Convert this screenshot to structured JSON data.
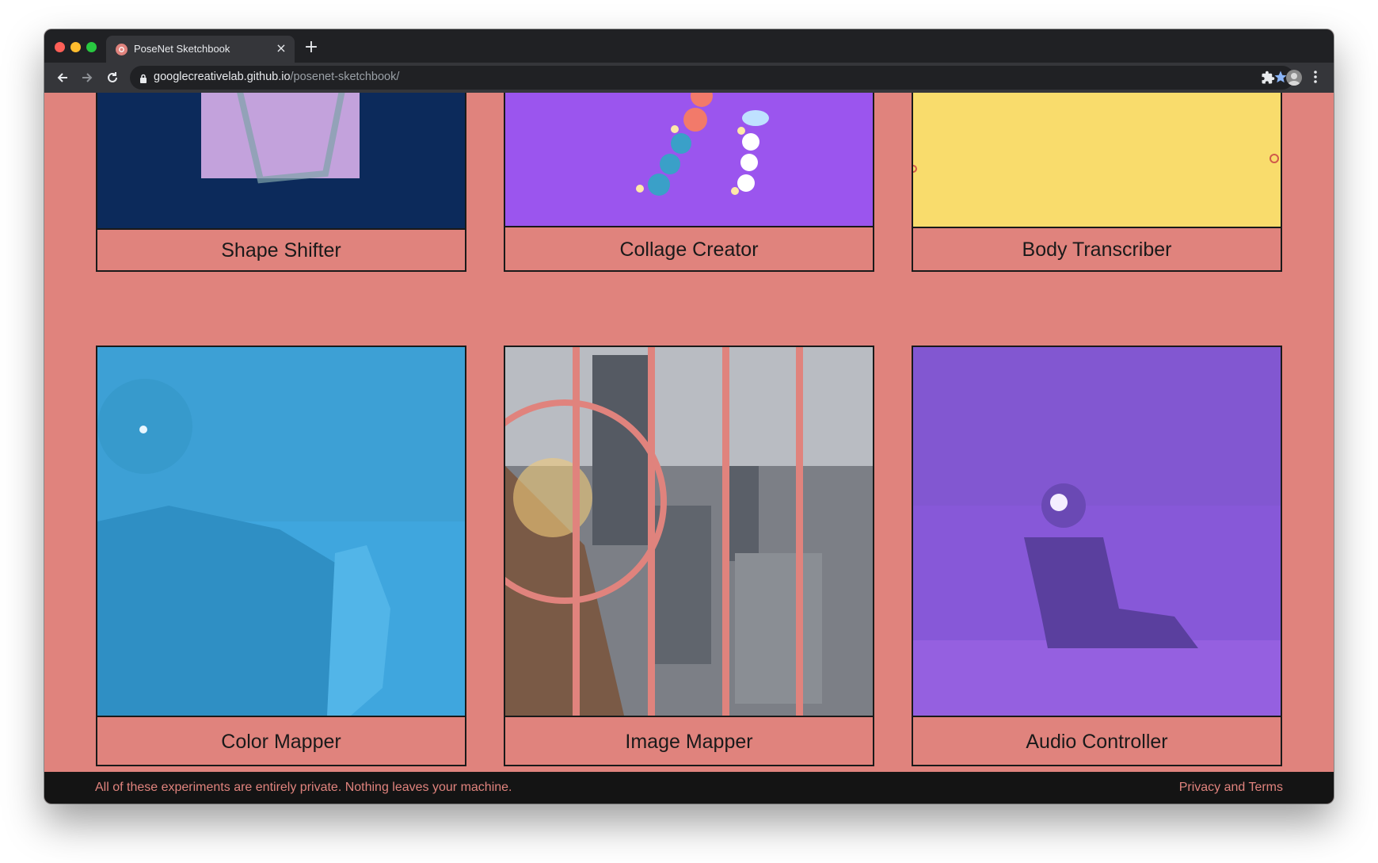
{
  "browser": {
    "tab_title": "PoseNet Sketchbook",
    "tab_close": "×",
    "new_tab": "+",
    "url_host": "googlecreativelab.github.io",
    "url_path": "/posenet-sketchbook/"
  },
  "cards": [
    {
      "label": "Shape Shifter",
      "bg": "#0c2a5b"
    },
    {
      "label": "Collage Creator",
      "bg": "#9b55ee"
    },
    {
      "label": "Body Transcriber",
      "bg": "#f9dc6c"
    },
    {
      "label": "Color Mapper",
      "bg": "#3fa6de"
    },
    {
      "label": "Image Mapper",
      "bg": "#7c7f86"
    },
    {
      "label": "Audio Controller",
      "bg": "#8758d8"
    }
  ],
  "footer": {
    "note": "All of these experiments are entirely private. Nothing leaves your machine.",
    "privacy_link": "Privacy and Terms"
  },
  "colors": {
    "page_bg": "#e0837d",
    "border": "#1a1a1a",
    "footer_bg": "#141414"
  }
}
